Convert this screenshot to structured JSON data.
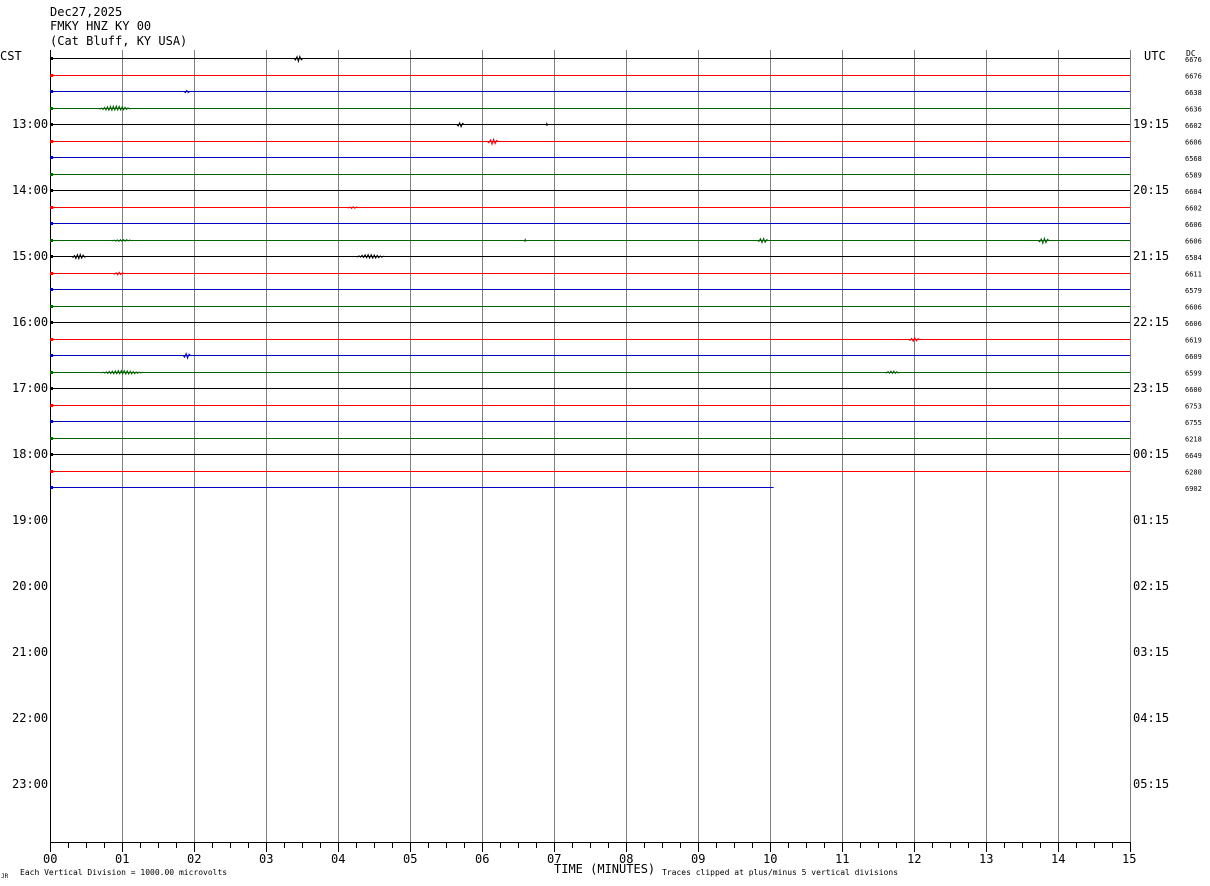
{
  "header": {
    "date": "Dec27,2025",
    "station": "FMKY HNZ KY 00",
    "location": "(Cat Bluff, KY USA)"
  },
  "left_axis_label": "CST",
  "right_axis_label": "UTC",
  "dc_label": "DC",
  "footer": {
    "scale_note": "Each Vertical Division = 1000.00 microvolts",
    "clip_note": "Traces clipped at plus/minus 5 vertical divisions",
    "mark": "JR"
  },
  "colors": {
    "trace_cycle": [
      "#000000",
      "#ff0000",
      "#0000c0",
      "#006400"
    ],
    "grid": "#808080"
  },
  "chart_data": {
    "type": "line",
    "subtype": "helicorder",
    "title": "FMKY HNZ KY 00",
    "xlabel": "TIME (MINUTES)",
    "xlim": [
      0,
      15
    ],
    "x_ticks": [
      "00",
      "01",
      "02",
      "03",
      "04",
      "05",
      "06",
      "07",
      "08",
      "09",
      "10",
      "11",
      "12",
      "13",
      "14",
      "15"
    ],
    "minor_ticks_per_minute": 4,
    "row_minutes": 15,
    "rows_total": 48,
    "left_time_labels": [
      "13:00",
      "14:00",
      "15:00",
      "16:00",
      "17:00",
      "18:00",
      "19:00",
      "20:00",
      "21:00",
      "22:00",
      "23:00"
    ],
    "right_time_labels": [
      "19:15",
      "20:15",
      "21:15",
      "22:15",
      "23:15",
      "00:15",
      "01:15",
      "02:15",
      "03:15",
      "04:15",
      "05:15"
    ],
    "time_label_start_row": 4,
    "time_label_every_rows": 4,
    "traces": [
      {
        "row": 0,
        "dc": "6676",
        "end_minute": 15,
        "bursts": [
          {
            "x": 3.45,
            "w": 0.12,
            "a": 3
          }
        ]
      },
      {
        "row": 1,
        "dc": "6676",
        "end_minute": 15,
        "bursts": []
      },
      {
        "row": 2,
        "dc": "6638",
        "end_minute": 15,
        "bursts": [
          {
            "x": 1.9,
            "w": 0.08,
            "a": 1.5
          }
        ]
      },
      {
        "row": 3,
        "dc": "6636",
        "end_minute": 15,
        "bursts": [
          {
            "x": 0.9,
            "w": 0.45,
            "a": 2.5
          }
        ]
      },
      {
        "row": 4,
        "dc": "6602",
        "end_minute": 15,
        "bursts": [
          {
            "x": 5.7,
            "w": 0.1,
            "a": 2.5
          },
          {
            "x": 6.9,
            "w": 0.03,
            "a": 1
          }
        ]
      },
      {
        "row": 5,
        "dc": "6606",
        "end_minute": 15,
        "bursts": [
          {
            "x": 6.15,
            "w": 0.15,
            "a": 3
          }
        ]
      },
      {
        "row": 6,
        "dc": "6568",
        "end_minute": 15,
        "bursts": []
      },
      {
        "row": 7,
        "dc": "6589",
        "end_minute": 15,
        "bursts": []
      },
      {
        "row": 8,
        "dc": "6604",
        "end_minute": 15,
        "bursts": []
      },
      {
        "row": 9,
        "dc": "6602",
        "end_minute": 15,
        "bursts": [
          {
            "x": 4.2,
            "w": 0.15,
            "a": 1
          }
        ]
      },
      {
        "row": 10,
        "dc": "6606",
        "end_minute": 15,
        "bursts": []
      },
      {
        "row": 11,
        "dc": "6606",
        "end_minute": 15,
        "bursts": [
          {
            "x": 1.0,
            "w": 0.3,
            "a": 1
          },
          {
            "x": 6.6,
            "w": 0.03,
            "a": 1
          },
          {
            "x": 9.9,
            "w": 0.15,
            "a": 2.5
          },
          {
            "x": 13.8,
            "w": 0.15,
            "a": 3
          }
        ]
      },
      {
        "row": 12,
        "dc": "6584",
        "end_minute": 15,
        "bursts": [
          {
            "x": 0.4,
            "w": 0.2,
            "a": 2.5
          },
          {
            "x": 4.45,
            "w": 0.4,
            "a": 2
          }
        ]
      },
      {
        "row": 13,
        "dc": "6611",
        "end_minute": 15,
        "bursts": [
          {
            "x": 0.95,
            "w": 0.15,
            "a": 1.5
          }
        ]
      },
      {
        "row": 14,
        "dc": "6579",
        "end_minute": 15,
        "bursts": []
      },
      {
        "row": 15,
        "dc": "6606",
        "end_minute": 15,
        "bursts": []
      },
      {
        "row": 16,
        "dc": "6606",
        "end_minute": 15,
        "bursts": []
      },
      {
        "row": 17,
        "dc": "6619",
        "end_minute": 15,
        "bursts": [
          {
            "x": 12.0,
            "w": 0.15,
            "a": 2
          }
        ]
      },
      {
        "row": 18,
        "dc": "6609",
        "end_minute": 15,
        "bursts": [
          {
            "x": 1.9,
            "w": 0.1,
            "a": 3
          }
        ]
      },
      {
        "row": 19,
        "dc": "6599",
        "end_minute": 15,
        "bursts": [
          {
            "x": 1.0,
            "w": 0.6,
            "a": 2
          },
          {
            "x": 11.7,
            "w": 0.2,
            "a": 1.5
          }
        ]
      },
      {
        "row": 20,
        "dc": "6600",
        "end_minute": 15,
        "bursts": []
      },
      {
        "row": 21,
        "dc": "6753",
        "end_minute": 15,
        "bursts": []
      },
      {
        "row": 22,
        "dc": "6755",
        "end_minute": 15,
        "bursts": []
      },
      {
        "row": 23,
        "dc": "6218",
        "end_minute": 15,
        "bursts": []
      },
      {
        "row": 24,
        "dc": "6649",
        "end_minute": 15,
        "bursts": []
      },
      {
        "row": 25,
        "dc": "6280",
        "end_minute": 15,
        "bursts": []
      },
      {
        "row": 26,
        "dc": "6902",
        "end_minute": 10.05,
        "bursts": []
      }
    ]
  }
}
